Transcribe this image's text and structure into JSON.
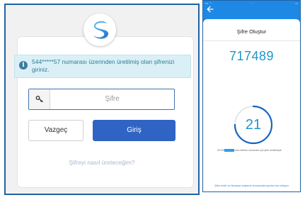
{
  "login": {
    "info_text": "544*****57 numarası üzerinden üretilmiş olan şifrenizi giriniz.",
    "password_placeholder": "Şifre",
    "cancel_label": "Vazgeç",
    "login_label": "Giriş",
    "help_link": "Şifreyi nasıl üreteceğim?"
  },
  "phone": {
    "title": "Şifre Oluştur",
    "otp_code": "717489",
    "countdown": "21",
    "countdown_remaining_fraction": 0.75,
    "note_prefix": "53760",
    "note_suffix": "'nolu telefon numarası için şifre üretilmiştir.",
    "bottom_link": "Şifre nedir ve kimseye söyleme konusunda yardım için tıklayın"
  },
  "colors": {
    "frame_border": "#1f62a3",
    "login_button": "#2f64c4",
    "phone_header": "#1e88e5",
    "accent": "#2196c8"
  }
}
